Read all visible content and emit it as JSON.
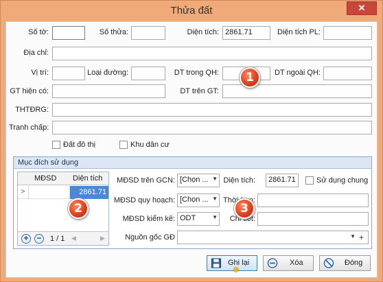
{
  "window": {
    "title": "Thửa đất",
    "close_glyph": "✕"
  },
  "form": {
    "so_to": {
      "label": "Số tờ:",
      "value": ""
    },
    "so_thua": {
      "label": "Số thửa:",
      "value": ""
    },
    "dien_tich": {
      "label": "Diện tích:",
      "value": "2861.71"
    },
    "dien_tich_pl": {
      "label": "Diện tích PL:",
      "value": ""
    },
    "dia_chi": {
      "label": "Địa chỉ:",
      "value": ""
    },
    "vi_tri": {
      "label": "Vị trí:",
      "value": ""
    },
    "loai_duong": {
      "label": "Loại đường:",
      "value": ""
    },
    "dt_trong_qh": {
      "label": "DT trong QH:",
      "value": ""
    },
    "dt_ngoai_qh": {
      "label": "DT ngoài QH:",
      "value": ""
    },
    "gt_hien_co": {
      "label": "GT hiện có:",
      "value": ""
    },
    "dt_tren_gt": {
      "label": "DT trên GT:",
      "value": ""
    },
    "thtdrg": {
      "label": "THTĐRG:",
      "value": ""
    },
    "tranh_chap": {
      "label": "Tranh chấp:",
      "value": ""
    },
    "dat_do_thi": {
      "label": "Đất đô thị",
      "checked": false
    },
    "khu_dan_cu": {
      "label": "Khu dân cư",
      "checked": false
    }
  },
  "badges": [
    "1",
    "2",
    "3"
  ],
  "purpose": {
    "header": "Mục đích sử dụng",
    "grid": {
      "columns": [
        "MĐSD",
        "Diện tích"
      ],
      "rows": [
        {
          "indicator": ">",
          "mdsd": "",
          "dien_tich": "2861.71"
        }
      ],
      "pager": "1 / 1"
    },
    "mdsd_tren_gcn": {
      "label": "MĐSD trên GCN:",
      "value": "[Chọn ..."
    },
    "dien_tich": {
      "label": "Diện tích:",
      "value": "2861.71"
    },
    "su_dung_chung": {
      "label": "Sử dụng chung",
      "checked": false
    },
    "mdsd_quy_hoach": {
      "label": "MĐSD quy hoạch:",
      "value": "[Chọn ..."
    },
    "thoi_han": {
      "label": "Thời hạn:",
      "value": ""
    },
    "mdsd_kiem_ke": {
      "label": "MĐSD kiểm kê:",
      "value": "ODT"
    },
    "chi_tiet": {
      "label": "Chi tiết:",
      "value": ""
    },
    "nguon_goc": {
      "label": "Nguồn gốc GĐ",
      "value": ""
    }
  },
  "buttons": {
    "save": "Ghi lại",
    "delete": "Xóa",
    "close": "Đóng"
  },
  "colors": {
    "accent": "#4a87d6",
    "badge": "#e0401e",
    "frame": "#f0a978"
  }
}
